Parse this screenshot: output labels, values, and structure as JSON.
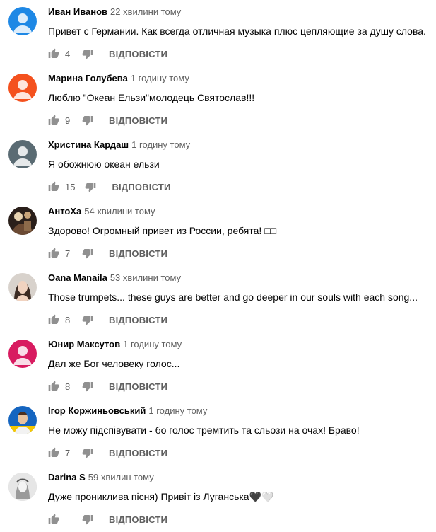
{
  "icons": {
    "like": "thumb-up-icon",
    "dislike": "thumb-down-icon"
  },
  "reply_label": "ВІДПОВІСТИ",
  "comments": [
    {
      "author": "Иван Иванов",
      "time": "22 хвилини тому",
      "text": "Привет с Германии. Как всегда отличная музыка плюс цепляющие за душу слова.",
      "likes": "4",
      "avatar_color": "#1e88e5",
      "avatar_kind": "default"
    },
    {
      "author": "Марина Голубева",
      "time": "1 годину тому",
      "text": "Люблю \"Океан Ельзи\"молодець Святослав!!!",
      "likes": "9",
      "avatar_color": "#f4511e",
      "avatar_kind": "default"
    },
    {
      "author": "Христина Кардаш",
      "time": "1 годину тому",
      "text": "Я обожнюю океан ельзи",
      "likes": "15",
      "avatar_color": "#5a6b73",
      "avatar_kind": "default"
    },
    {
      "author": "АнтоХа",
      "time": "54 хвилини тому",
      "text": "Здорово! Огромный привет из России, ребята! □□",
      "likes": "7",
      "avatar_color": "#2a1f1a",
      "avatar_kind": "photo-dark"
    },
    {
      "author": "Oana Manaila",
      "time": "53 хвилини тому",
      "text": "Those trumpets... these guys are better and go deeper in our souls with each song...",
      "likes": "8",
      "avatar_color": "#d8d2cc",
      "avatar_kind": "photo-woman"
    },
    {
      "author": "Юнир Максутов",
      "time": "1 годину тому",
      "text": "Дал же Бог человеку голос...",
      "likes": "8",
      "avatar_color": "#d81b60",
      "avatar_kind": "default"
    },
    {
      "author": "Ігор Коржиньовський",
      "time": "1 годину тому",
      "text": "Не можу підспівувати - бо голос тремтить та сльози на очах! Браво!",
      "likes": "7",
      "avatar_color": "#1565c0",
      "avatar_kind": "photo-man"
    },
    {
      "author": "Darina S",
      "time": "59 хвилин тому",
      "text": "Дуже прониклива пісня) Привіт із Луганська🖤🤍",
      "likes": "",
      "avatar_color": "#cfcfcf",
      "avatar_kind": "photo-sketch"
    }
  ]
}
